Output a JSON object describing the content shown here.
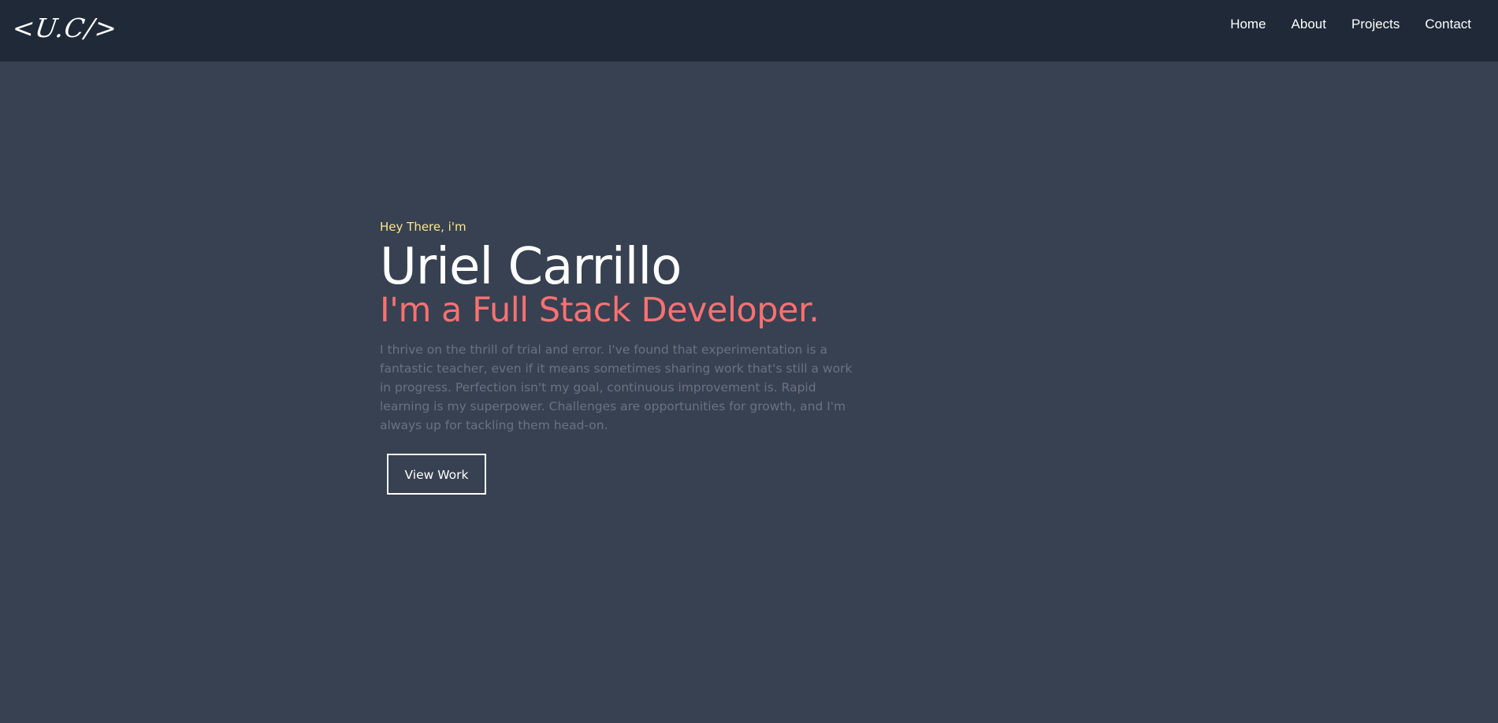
{
  "nav": {
    "logo": "<U.C/>",
    "links": [
      "Home",
      "About",
      "Projects",
      "Contact"
    ]
  },
  "hero": {
    "greeting": "Hey There, i'm",
    "name": "Uriel Carrillo",
    "role": "I'm a Full Stack Developer.",
    "bio": "I thrive on the thrill of trial and error. I've found that experimentation is a fantastic teacher, even if it means sometimes sharing work that's still a work in progress. Perfection isn't my goal, continuous improvement is. Rapid learning is my superpower. Challenges are opportunities for growth, and I'm always up for tackling them head-on.",
    "button_label": "View Work"
  },
  "colors": {
    "background": "#374151",
    "navbar": "#1f2937",
    "greeting": "#fde68a",
    "role": "#f87171",
    "bio": "#6b7280"
  }
}
